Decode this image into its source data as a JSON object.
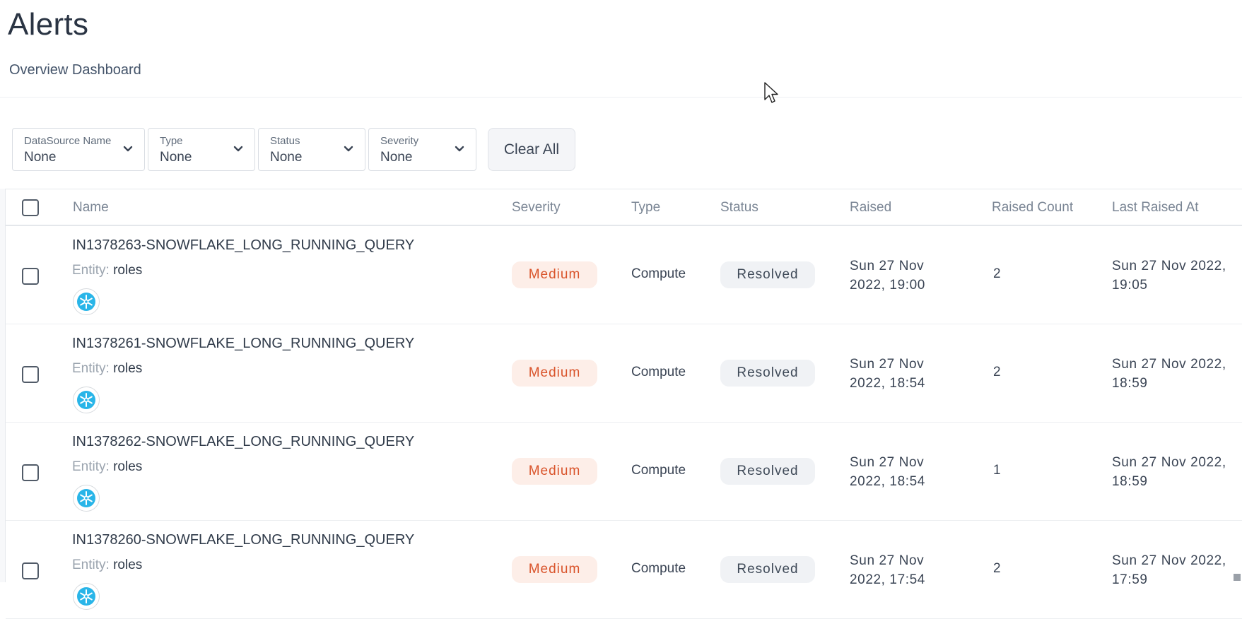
{
  "header": {
    "title": "Alerts",
    "subnav": "Overview Dashboard"
  },
  "filters": [
    {
      "label": "DataSource Name",
      "value": "None"
    },
    {
      "label": "Type",
      "value": "None"
    },
    {
      "label": "Status",
      "value": "None"
    },
    {
      "label": "Severity",
      "value": "None"
    }
  ],
  "clear_all_label": "Clear All",
  "table": {
    "columns": [
      "Name",
      "Severity",
      "Type",
      "Status",
      "Raised",
      "Raised Count",
      "Last Raised At"
    ],
    "entity_label": "Entity:",
    "rows": [
      {
        "name": "IN1378263-SNOWFLAKE_LONG_RUNNING_QUERY",
        "entity": "roles",
        "severity": "Medium",
        "type": "Compute",
        "status": "Resolved",
        "raised_line1": "Sun 27 Nov",
        "raised_line2": "2022, 19:00",
        "raised_count": "2",
        "last_line1": "Sun 27 Nov 2022,",
        "last_line2": "19:05",
        "icon": "snowflake-icon"
      },
      {
        "name": "IN1378261-SNOWFLAKE_LONG_RUNNING_QUERY",
        "entity": "roles",
        "severity": "Medium",
        "type": "Compute",
        "status": "Resolved",
        "raised_line1": "Sun 27 Nov",
        "raised_line2": "2022, 18:54",
        "raised_count": "2",
        "last_line1": "Sun 27 Nov 2022,",
        "last_line2": "18:59",
        "icon": "snowflake-icon"
      },
      {
        "name": "IN1378262-SNOWFLAKE_LONG_RUNNING_QUERY",
        "entity": "roles",
        "severity": "Medium",
        "type": "Compute",
        "status": "Resolved",
        "raised_line1": "Sun 27 Nov",
        "raised_line2": "2022, 18:54",
        "raised_count": "1",
        "last_line1": "Sun 27 Nov 2022,",
        "last_line2": "18:59",
        "icon": "snowflake-icon"
      },
      {
        "name": "IN1378260-SNOWFLAKE_LONG_RUNNING_QUERY",
        "entity": "roles",
        "severity": "Medium",
        "type": "Compute",
        "status": "Resolved",
        "raised_line1": "Sun 27 Nov",
        "raised_line2": "2022, 17:54",
        "raised_count": "2",
        "last_line1": "Sun 27 Nov 2022,",
        "last_line2": "17:59",
        "icon": "snowflake-icon"
      }
    ]
  },
  "colors": {
    "severity_medium_bg": "#fdeee8",
    "severity_medium_text": "#d9532a",
    "status_bg": "#f0f2f5",
    "snowflake_icon": "#29b5e8"
  }
}
